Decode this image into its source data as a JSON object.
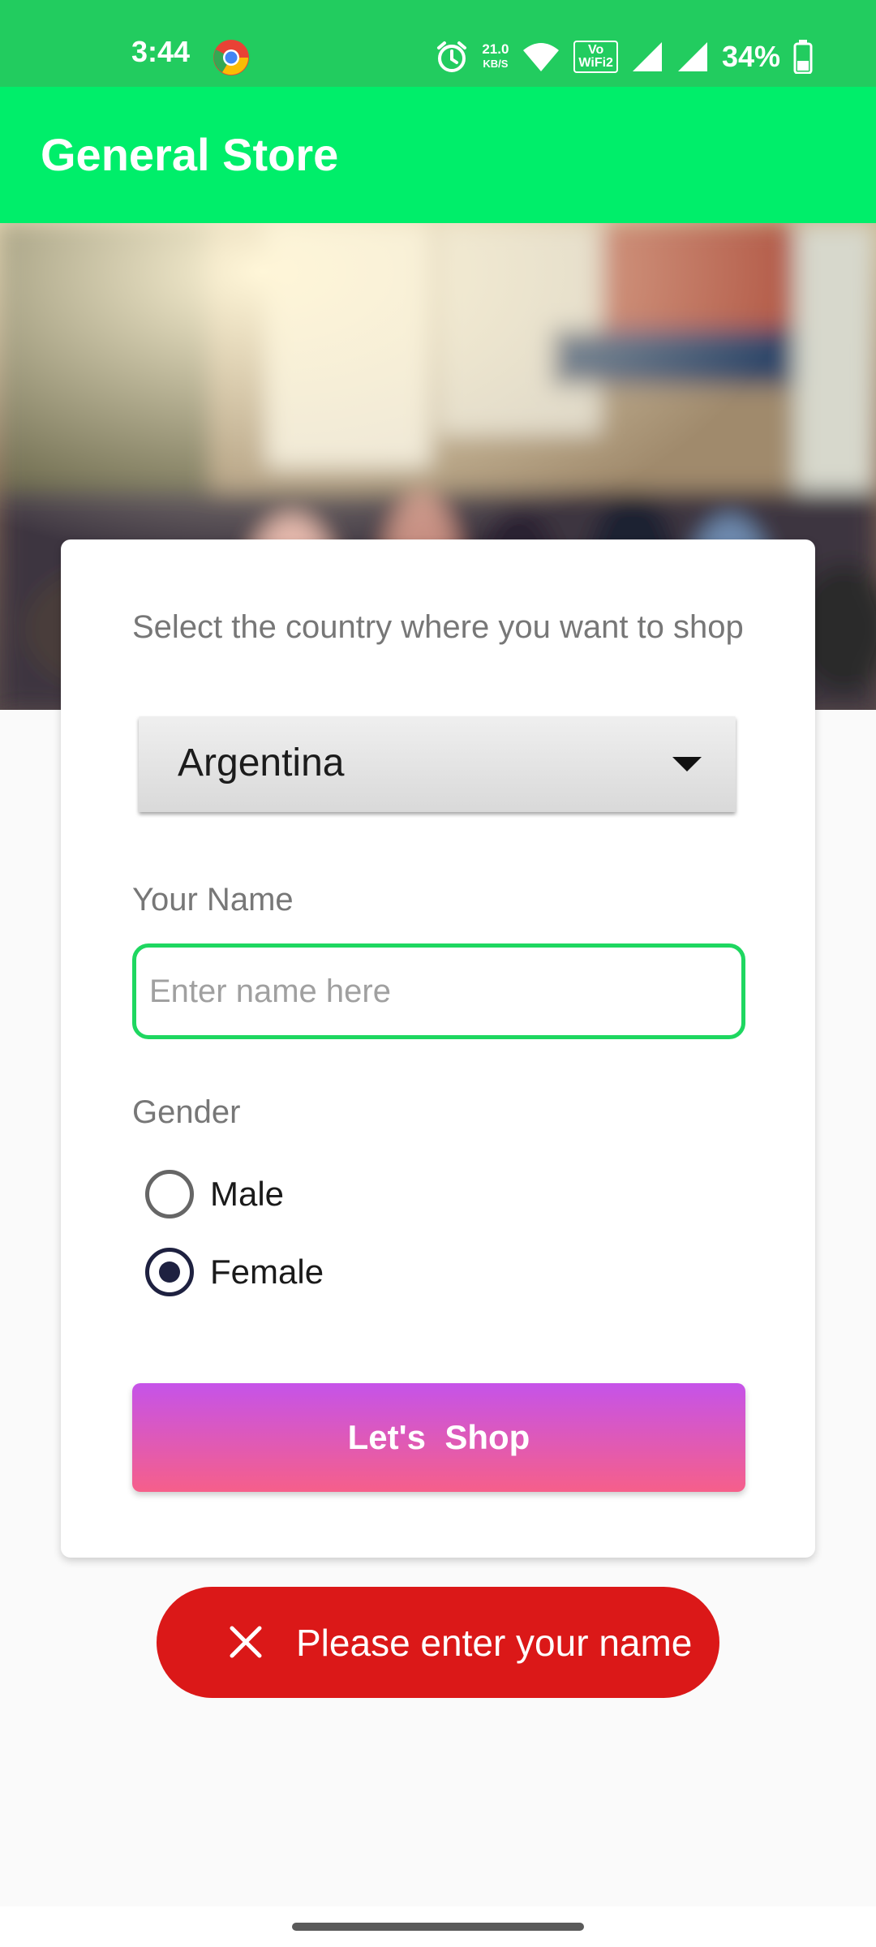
{
  "status_bar": {
    "time": "3:44",
    "network_speed_value": "21.0",
    "network_speed_unit": "KB/S",
    "wifi_calling_line1": "Vo",
    "wifi_calling_line2": "WiFi2",
    "battery_percent": "34%",
    "icons": [
      "chrome-icon",
      "alarm-icon",
      "wifi-icon",
      "signal-icon",
      "signal-icon",
      "battery-icon"
    ]
  },
  "app_bar": {
    "title": "General Store"
  },
  "form": {
    "country_label": "Select the country where you want to shop",
    "country_selected": "Argentina",
    "name_label": "Your Name",
    "name_value": "",
    "name_placeholder": "Enter name here",
    "gender_label": "Gender",
    "gender_options": [
      {
        "label": "Male",
        "checked": false
      },
      {
        "label": "Female",
        "checked": true
      }
    ],
    "submit_label": "Let's  Shop"
  },
  "toast": {
    "icon": "close-icon",
    "message": "Please enter your name"
  },
  "colors": {
    "status_bar": "#22cc5f",
    "app_bar": "#00ee6a",
    "input_border": "#1ed760",
    "button_gradient_top": "#c553e9",
    "button_gradient_bottom": "#f65f8a",
    "toast_bg": "#db1818",
    "radio_checked": "#1e2140"
  }
}
